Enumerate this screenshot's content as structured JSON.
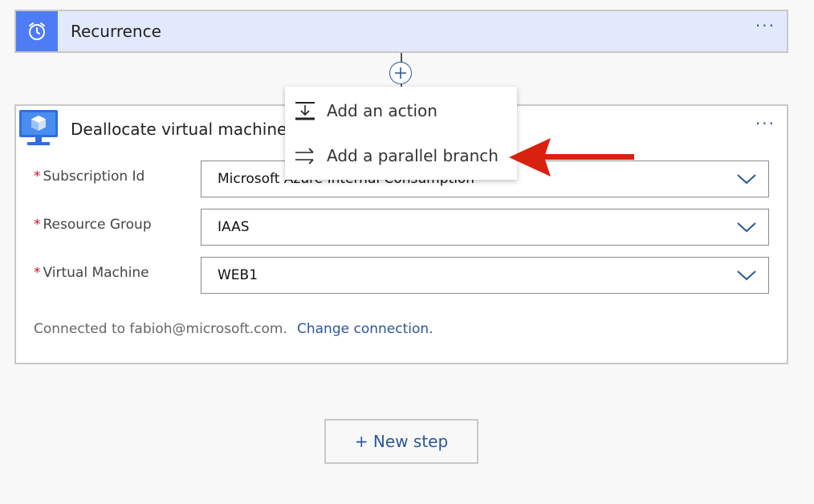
{
  "recurrence": {
    "title": "Recurrence",
    "icon": "alarm-clock-icon",
    "menu": "···"
  },
  "deallocate": {
    "title": "Deallocate virtual machine (",
    "icon": "virtual-machine-icon",
    "menu": "···",
    "fields": [
      {
        "label": "Subscription Id",
        "value": "Microsoft Azure Internal Consumption",
        "required": "*"
      },
      {
        "label": "Resource Group",
        "value": "IAAS",
        "required": "*"
      },
      {
        "label": "Virtual Machine",
        "value": "WEB1",
        "required": "*"
      }
    ],
    "connected_text": "Connected to fabioh@microsoft.com.",
    "change_connection": "Change connection."
  },
  "insert_menu": {
    "items": [
      {
        "label": "Add an action",
        "icon": "add-action-icon"
      },
      {
        "label": "Add a parallel branch",
        "icon": "parallel-branch-icon"
      }
    ]
  },
  "new_step": {
    "label": "+ New step"
  },
  "colors": {
    "trigger_bg": "#e3e9fc",
    "trigger_icon_bg": "#4d7cf5",
    "link": "#2b5799",
    "required": "#c8102e",
    "annotation_arrow": "#d9210f"
  }
}
